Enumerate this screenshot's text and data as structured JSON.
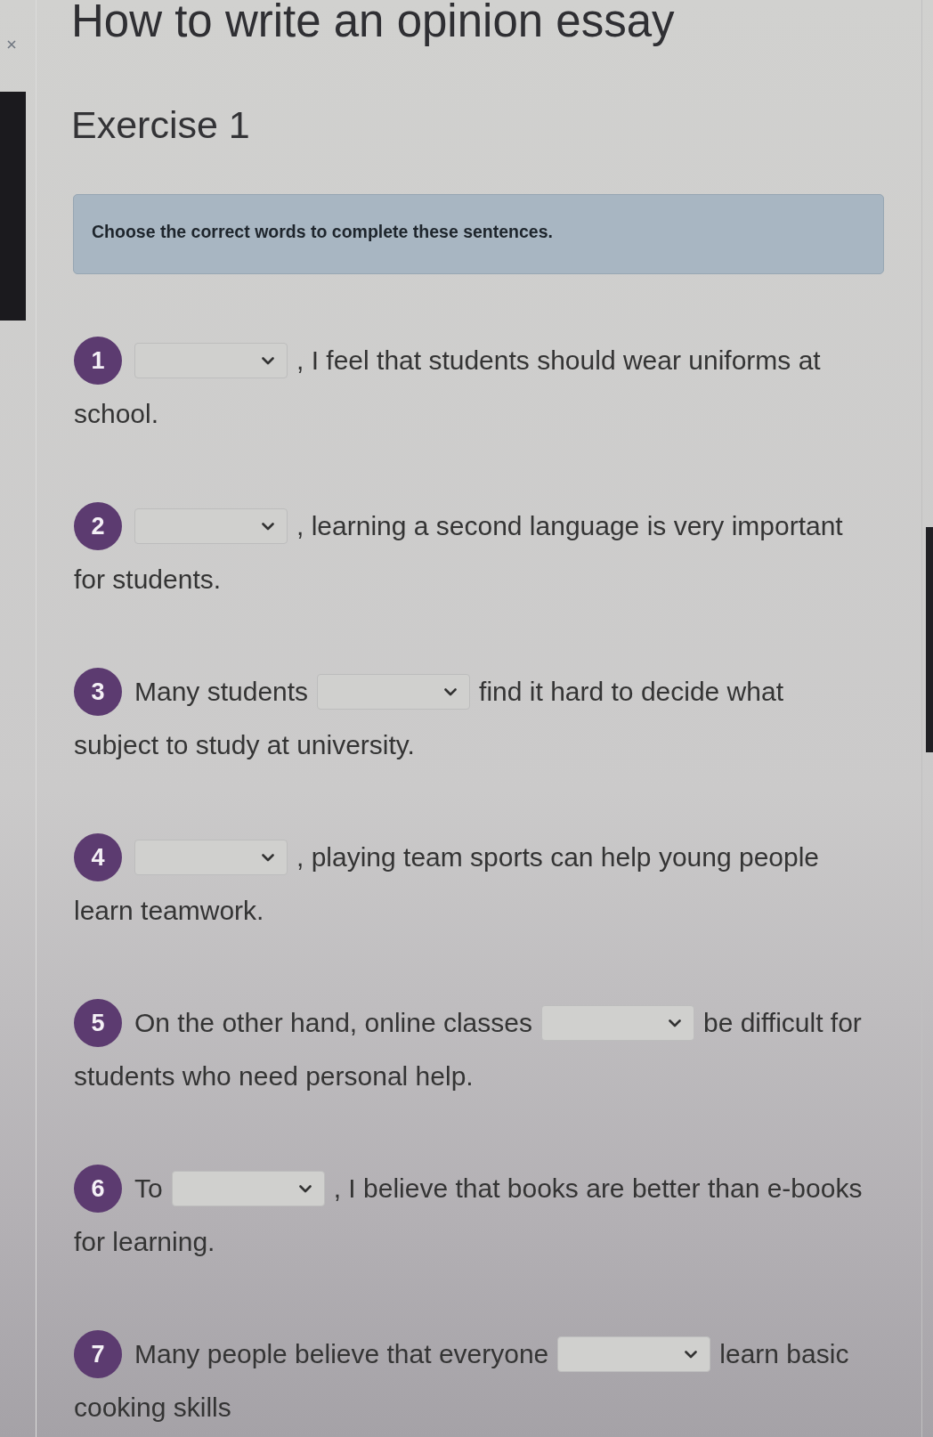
{
  "header": {
    "title": "How to write an opinion essay"
  },
  "exercise": {
    "heading": "Exercise 1",
    "instructions": "Choose the correct words to complete these sentences.",
    "questions": [
      {
        "number": "1",
        "after": ", I feel that students should wear uniforms at",
        "continuation": "school."
      },
      {
        "number": "2",
        "after": ", learning a second language is very important",
        "continuation": "for students."
      },
      {
        "number": "3",
        "before": "Many students",
        "after": "find it hard to decide what",
        "continuation": "subject to study at university."
      },
      {
        "number": "4",
        "after": ", playing team sports can help young people",
        "continuation": "learn teamwork."
      },
      {
        "number": "5",
        "before": "On the other hand, online classes",
        "after": "be difficult for",
        "continuation": "students who need personal help."
      },
      {
        "number": "6",
        "before": "To",
        "after": ", I believe that books are better than e-books",
        "continuation": "for learning."
      },
      {
        "number": "7",
        "before": "Many people believe that everyone",
        "after": "learn basic",
        "continuation": "cooking skills"
      }
    ]
  }
}
